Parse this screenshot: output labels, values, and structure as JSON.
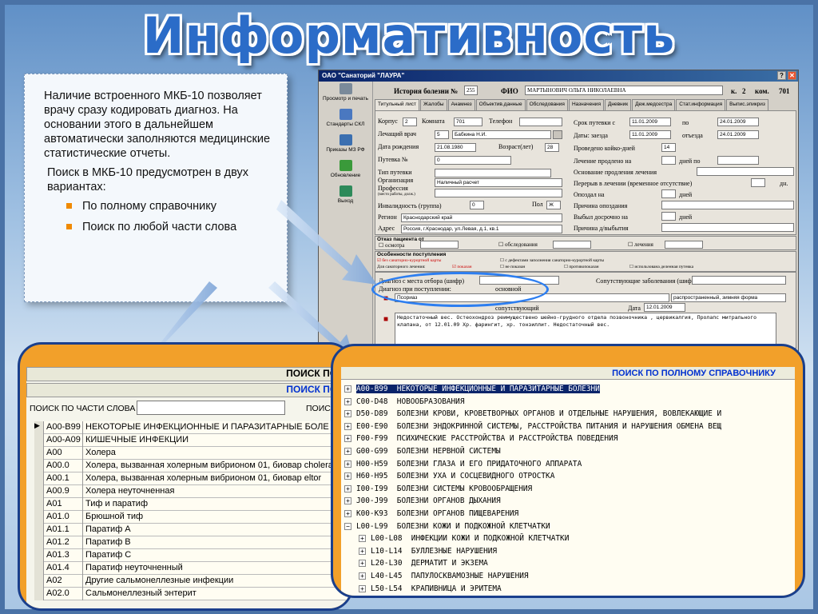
{
  "title": "Информативность",
  "note": {
    "p1": "Наличие встроенного МКБ-10 позволяет врачу сразу кодировать диагноз. На основании этого в дальнейшем автоматически заполняются медицинские статистические отчеты.",
    "p2": "Поиск в МКБ-10 предусмотрен в двух вариантах:",
    "items": [
      "По полному справочнику",
      "Поиск по любой части слова"
    ]
  },
  "form": {
    "window_title": "ОАО \"Санаторий \"ЛАУРА\"",
    "toolbar": [
      "Просмотр и печать",
      "Стандарты СКЛ",
      "Приказы МЗ РФ",
      "Обновление",
      "Выход"
    ],
    "header": {
      "label_history": "История болезни №",
      "history_no": "255",
      "label_fio": "ФИО",
      "fio": "МАРТЫНОВИЧ ОЛЬГА НИКОЛАЕВНА",
      "label_k": "к.",
      "k": "2",
      "label_kom": "ком.",
      "kom": "701"
    },
    "tabs": [
      "Титульный лист",
      "Жалобы",
      "Анамнез",
      "Объектив.данные",
      "Обследования",
      "Назначения",
      "Дневник",
      "Деж.медсестра",
      "Стат.информация",
      "Выпис.эпикриз"
    ],
    "left": {
      "korpus": "Корпус",
      "korpus_v": "2",
      "komnata": "Комната",
      "komnata_v": "701",
      "telefon": "Телефон",
      "vrach": "Лечащий врач",
      "vrach_n": "5",
      "vrach_v": "Бабкина Н.И.",
      "dr": "Дата рождения",
      "dr_v": "21.08.1980",
      "vozr": "Возраст(лет)",
      "vozr_v": "28",
      "putevka": "Путевка №",
      "putevka_v": "0",
      "tip": "Тип путевки",
      "org": "Организация",
      "org_v": "Наличный расчет",
      "prof": "Профессия",
      "prof_sub": "(место работы, долж.)",
      "inv": "Инвалидность (группа)",
      "inv_v": "0",
      "pol": "Пол",
      "pol_v": "Ж",
      "region": "Регион",
      "region_v": "Краснодарский край",
      "adres": "Адрес",
      "adres_v": "Россия, г.Краснодар, ул.Левая, д.1, кв.1"
    },
    "right": {
      "srok": "Срок путевки с",
      "srok_s": "11.01.2009",
      "po": "по",
      "srok_po": "24.01.2009",
      "daty": "Даты: заезда",
      "zaezd": "11.01.2009",
      "otezd_l": "отъезда",
      "otezd": "24.01.2009",
      "kd": "Проведено койко-дней",
      "kd_v": "14",
      "prodl": "Лечение продлено на",
      "dney_po": "дней по",
      "osn": "Основание продления лечения",
      "pereryv": "Перерыв в лечении (временное отсутствие)",
      "dn": "дн.",
      "opozdal": "Опоздал на",
      "dney": "дней",
      "prich_op": "Причина опоздания",
      "vybyl": "Выбыл досрочно на",
      "prich_vyb": "Причина д/выбытия"
    },
    "otkaz": {
      "title": "Отказ пациента от",
      "osm": "осмотра",
      "obsl": "обследования",
      "lech": "лечения"
    },
    "osob": {
      "title": "Особенности поступления",
      "a": "без санаторно-курортной карты",
      "b": "с дефектами заполнения санаторно-курортной карты",
      "c": "Для санаторного лечения:",
      "d": "показан",
      "e": "не показан",
      "f": "противопоказан",
      "g": "использована деленная путевка"
    },
    "diag": {
      "napr": "Диагноз с места отбора (шифр)",
      "soput": "Сопутствующие заболевания (шифр)",
      "postup": "Диагноз при поступлении:",
      "osn": "основной",
      "diag_v": "Псориаз",
      "diag_r": "распространенный, зимняя форма",
      "soput2": "сопутствующий",
      "data": "Дата",
      "data_v": "12.01.2009",
      "text": "Недостаточный вес. Остеохондроз реимуществено шейно-грудного отдела позвоночника , цервикалгия, Пролапс митрального клапана, от 12.01.09 Хр. фарингит, хр. тонзиллит. Недостаточный вес."
    }
  },
  "panel1": {
    "header": "ПОИСК ПО П",
    "subheader": "ПОИСК ПО Ч",
    "search_label": "ПОИСК ПО ЧАСТИ СЛОВА",
    "search_right": "ПОИСК",
    "rows": [
      [
        "A00-B99",
        "НЕКОТОРЫЕ ИНФЕКЦИОННЫЕ И ПАРАЗИТАРНЫЕ БОЛЕ"
      ],
      [
        "A00-A09",
        "КИШЕЧНЫЕ ИНФЕКЦИИ"
      ],
      [
        "A00",
        "Холера"
      ],
      [
        "A00.0",
        "Холера, вызванная холерным вибрионом 01, биовар cholera"
      ],
      [
        "A00.1",
        "Холера, вызванная холерным вибрионом 01, биовар eltor"
      ],
      [
        "A00.9",
        "Холера неуточненная"
      ],
      [
        "A01",
        "Тиф и паратиф"
      ],
      [
        "A01.0",
        "Брюшной тиф"
      ],
      [
        "A01.1",
        "Паратиф А"
      ],
      [
        "A01.2",
        "Паратиф В"
      ],
      [
        "A01.3",
        "Паратиф С"
      ],
      [
        "A01.4",
        "Паратиф неуточненный"
      ],
      [
        "A02",
        "Другие сальмонеллезные инфекции"
      ],
      [
        "A02.0",
        "Сальмонеллезный энтерит"
      ]
    ]
  },
  "panel2": {
    "header": "ПОИСК ПО ПОЛНОМУ СПРАВОЧНИКУ",
    "rows": [
      [
        "+",
        "A00-B99  НЕКОТОРЫЕ ИНФЕКЦИОННЫЕ И ПАРАЗИТАРНЫЕ БОЛЕЗНИ",
        0
      ],
      [
        "+",
        "C00-D48  НОВООБРАЗОВАНИЯ",
        0
      ],
      [
        "+",
        "D50-D89  БОЛЕЗНИ КРОВИ, КРОВЕТВОРНЫХ ОРГАНОВ И ОТДЕЛЬНЫЕ НАРУШЕНИЯ, ВОВЛЕКАЮЩИЕ И",
        0
      ],
      [
        "+",
        "E00-E90  БОЛЕЗНИ ЭНДОКРИННОЙ СИСТЕМЫ, РАССТРОЙСТВА ПИТАНИЯ И НАРУШЕНИЯ ОБМЕНА ВЕЩ",
        0
      ],
      [
        "+",
        "F00-F99  ПСИХИЧЕСКИЕ РАССТРОЙСТВА И РАССТРОЙСТВА ПОВЕДЕНИЯ",
        0
      ],
      [
        "+",
        "G00-G99  БОЛЕЗНИ НЕРВНОЙ СИСТЕМЫ",
        0
      ],
      [
        "+",
        "H00-H59  БОЛЕЗНИ ГЛАЗА И ЕГО ПРИДАТОЧНОГО АППАРАТА",
        0
      ],
      [
        "+",
        "H60-H95  БОЛЕЗНИ УХА И СОСЦЕВИДНОГО ОТРОСТКА",
        0
      ],
      [
        "+",
        "I00-I99  БОЛЕЗНИ СИСТЕМЫ КРОВООБРАЩЕНИЯ",
        0
      ],
      [
        "+",
        "J00-J99  БОЛЕЗНИ ОРГАНОВ ДЫХАНИЯ",
        0
      ],
      [
        "+",
        "K00-K93  БОЛЕЗНИ ОРГАНОВ ПИЩЕВАРЕНИЯ",
        0
      ],
      [
        "−",
        "L00-L99  БОЛЕЗНИ КОЖИ И ПОДКОЖНОЙ КЛЕТЧАТКИ",
        0
      ],
      [
        "+",
        "L00-L08  ИНФЕКЦИИ КОЖИ И ПОДКОЖНОЙ КЛЕТЧАТКИ",
        1
      ],
      [
        "+",
        "L10-L14  БУЛЛЕЗНЫЕ НАРУШЕНИЯ",
        1
      ],
      [
        "+",
        "L20-L30  ДЕРМАТИТ И ЭКЗЕМА",
        1
      ],
      [
        "+",
        "L40-L45  ПАПУЛОСКВАМОЗНЫЕ НАРУШЕНИЯ",
        1
      ],
      [
        "+",
        "L50-L54  КРАПИВНИЦА И ЭРИТЕМА",
        1
      ]
    ]
  }
}
